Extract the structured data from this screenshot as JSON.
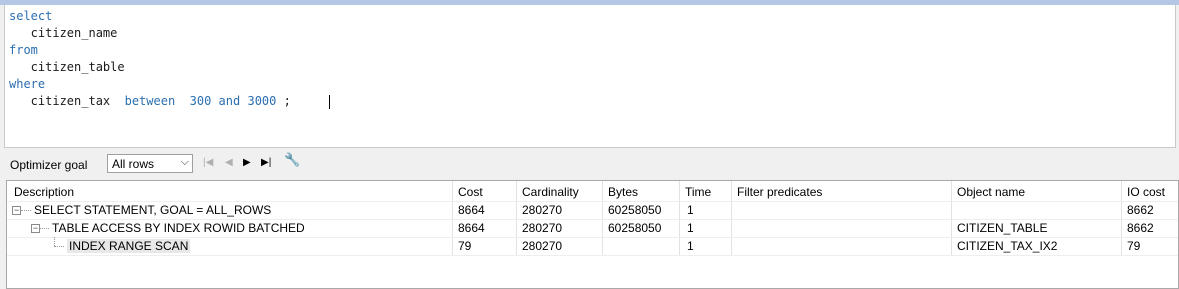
{
  "editor": {
    "lines": [
      {
        "kw": "select",
        "rest": ""
      },
      {
        "kw": "",
        "rest": "   citizen_name"
      },
      {
        "kw": "from",
        "rest": ""
      },
      {
        "kw": "",
        "rest": "   citizen_table"
      },
      {
        "kw": "where",
        "rest": ""
      }
    ],
    "last_line": {
      "ident": "   citizen_tax  ",
      "between": "between",
      "low": "300",
      "and": "and",
      "high": "3000",
      "semi": ";"
    }
  },
  "toolbar": {
    "optimizer_goal_label": "Optimizer goal",
    "optimizer_goal_value": "All rows",
    "dropdown_arrow": "⌵",
    "first": "|◀",
    "prev": "◀",
    "next": "▶",
    "last": "▶|",
    "wrench": "🔧"
  },
  "plan": {
    "columns": [
      "Description",
      "Cost",
      "Cardinality",
      "Bytes",
      "Time",
      "Filter predicates",
      "Object name",
      "IO cost"
    ],
    "rows": [
      {
        "description": "SELECT STATEMENT, GOAL = ALL_ROWS",
        "cost": "8664",
        "cardinality": "280270",
        "bytes": "60258050",
        "time": "1",
        "filter": "",
        "object": "",
        "io_cost": "8662"
      },
      {
        "description": "TABLE ACCESS BY INDEX ROWID BATCHED",
        "cost": "8664",
        "cardinality": "280270",
        "bytes": "60258050",
        "time": "1",
        "filter": "",
        "object": "CITIZEN_TABLE",
        "io_cost": "8662"
      },
      {
        "description": "INDEX RANGE SCAN",
        "cost": "79",
        "cardinality": "280270",
        "bytes": "",
        "time": "1",
        "filter": "",
        "object": "CITIZEN_TAX_IX2",
        "io_cost": "79"
      }
    ]
  },
  "colors": {
    "keyword": "#2c6fb0",
    "header_strip": "#b4c8e6"
  }
}
